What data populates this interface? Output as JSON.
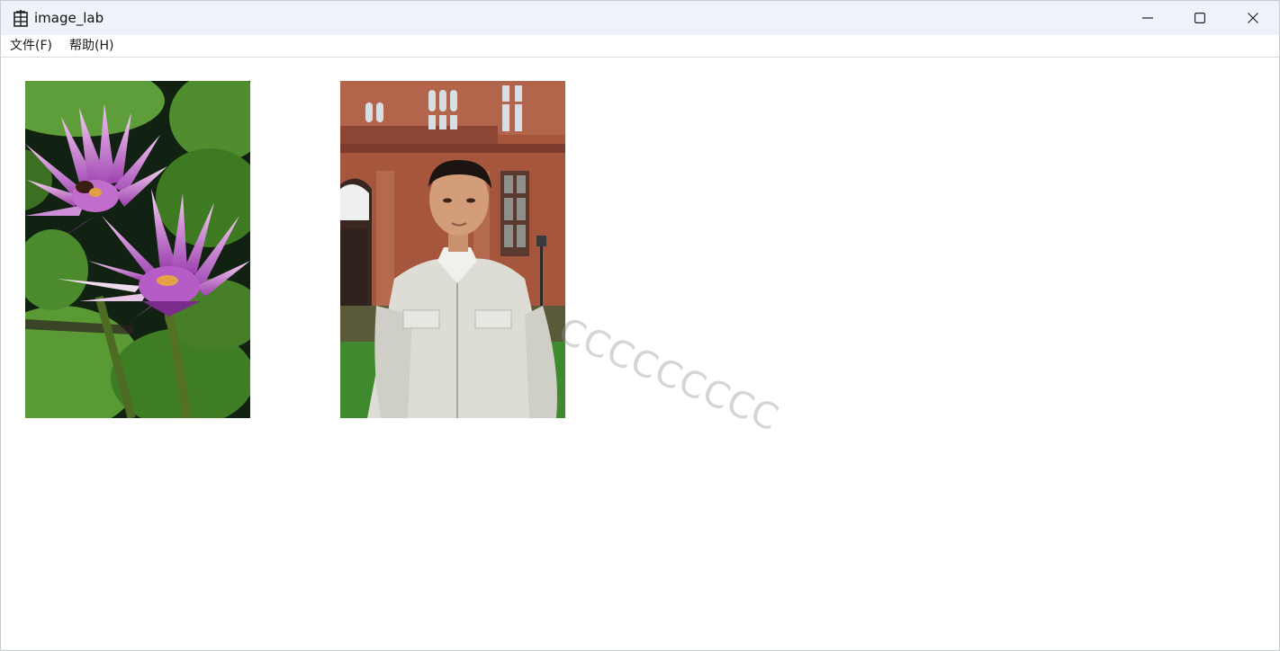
{
  "window": {
    "title": "image_lab",
    "icon": "app-grid-icon",
    "controls": [
      "minimize-icon",
      "maximize-icon",
      "close-icon"
    ]
  },
  "menu": {
    "items": [
      {
        "label": "文件(F)"
      },
      {
        "label": "帮助(H)"
      }
    ]
  },
  "content": {
    "images": [
      {
        "name": "lotus-flowers-photo",
        "subject": "pink water lilies with green lily pads"
      },
      {
        "name": "portrait-photo",
        "subject": "man in light jacket in front of red sandstone building"
      }
    ],
    "watermark": "CCCCCCCCC"
  },
  "colors": {
    "titlebar_bg": "#eef3fa",
    "menubar_bg": "#ffffff",
    "content_bg": "#ffffff"
  }
}
